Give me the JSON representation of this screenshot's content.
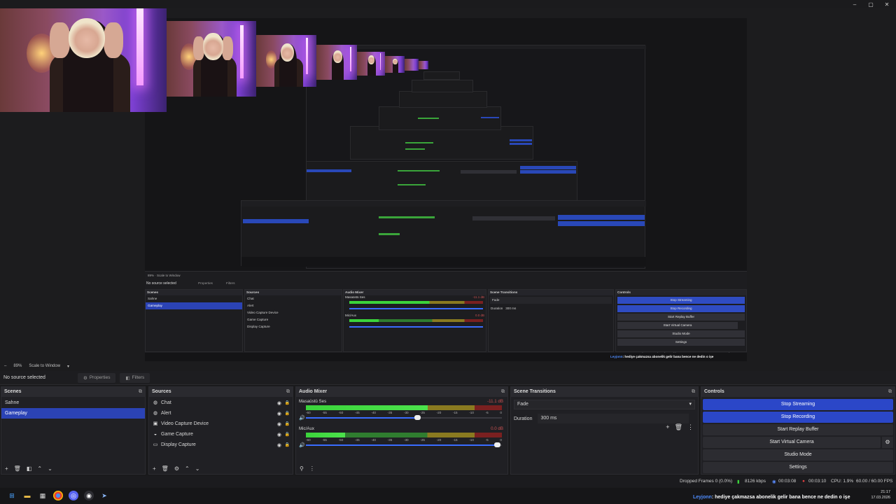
{
  "window": {
    "minimize": "–",
    "maximize": "▢",
    "close": "✕"
  },
  "preview": {
    "mini": {
      "no_source": "No source selected",
      "properties": "Properties",
      "filters": "Filters",
      "scenes_title": "Scenes",
      "scenes": [
        "Sahne",
        "Gameplay"
      ],
      "sources_title": "Sources",
      "sources": [
        "Chat",
        "Alert",
        "Video Capture Device",
        "Game Capture",
        "Display Capture"
      ],
      "mixer_title": "Audio Mixer",
      "mixer_channels": [
        "Masaüstü Ses",
        "Mic/Aux"
      ],
      "mixer_db": [
        "-11.1 dB",
        "0.0 dB"
      ],
      "transitions_title": "Scene Transitions",
      "transition": "Fade",
      "duration_label": "Duration",
      "duration": "300 ms",
      "controls_title": "Controls",
      "controls": [
        "Stop Streaming",
        "Stop Recording",
        "Start Replay Buffer",
        "Start Virtual Camera",
        "Studio Mode",
        "Settings"
      ],
      "status": "Dropped Frames 0 (0.0%)   8126 kbps   00:03:08   00:03:10   CPU: 1.9%   60.00 / 60.00 FPS",
      "zoom": "89%",
      "scale": "Scale to Window",
      "chat_user": "Leyjonn",
      "chat_text": ": hediye çakmazsa abonelik gelir bana bence ne dedin o işe"
    }
  },
  "statusrow": {
    "zoom": "89%",
    "scale_mode": "Scale to Window"
  },
  "context_bar": {
    "no_source": "No source selected",
    "properties": "Properties",
    "filters": "Filters"
  },
  "scenes": {
    "title": "Scenes",
    "items": [
      "Sahne",
      "Gameplay"
    ],
    "selected": "Gameplay"
  },
  "sources": {
    "title": "Sources",
    "items": [
      {
        "label": "Chat",
        "icon": "globe-icon"
      },
      {
        "label": "Alert",
        "icon": "globe-icon"
      },
      {
        "label": "Video Capture Device",
        "icon": "camera-icon"
      },
      {
        "label": "Game Capture",
        "icon": "gamepad-icon"
      },
      {
        "label": "Display Capture",
        "icon": "monitor-icon"
      }
    ]
  },
  "mixer": {
    "title": "Audio Mixer",
    "channels": [
      {
        "name": "Masaüstü Ses",
        "db": "-11.1 dB",
        "level": 0.62,
        "volume": 0.57
      },
      {
        "name": "Mic/Aux",
        "db": "0.0 dB",
        "level": 0.2,
        "volume": 0.98
      }
    ],
    "ticks": [
      "-60",
      "-55",
      "-50",
      "-45",
      "-40",
      "-35",
      "-30",
      "-25",
      "-20",
      "-15",
      "-10",
      "-5",
      "0"
    ]
  },
  "transitions": {
    "title": "Scene Transitions",
    "selected": "Fade",
    "duration_label": "Duration",
    "duration": "300 ms"
  },
  "controls": {
    "title": "Controls",
    "stop_streaming": "Stop Streaming",
    "stop_recording": "Stop Recording",
    "start_replay": "Start Replay Buffer",
    "start_virtual_camera": "Start Virtual Camera",
    "studio_mode": "Studio Mode",
    "settings": "Settings"
  },
  "status": {
    "dropped_frames": "Dropped Frames 0 (0.0%)",
    "bitrate": "8126 kbps",
    "stream_time": "00:03:08",
    "record_time": "00:03:10",
    "cpu": "CPU: 1.9%",
    "fps": "60.00 / 60.00 FPS"
  },
  "taskbar": {
    "chat_user": "Leyjonn",
    "chat_text": ": hediye çakmazsa abonelik gelir bana bence ne dedin o işe",
    "time": "21:17",
    "date": "17.03.2026"
  },
  "colors": {
    "accent": "#2b47c8",
    "selection": "#2b43b5",
    "panel": "#202024",
    "meter_green": "#3bd43b"
  }
}
